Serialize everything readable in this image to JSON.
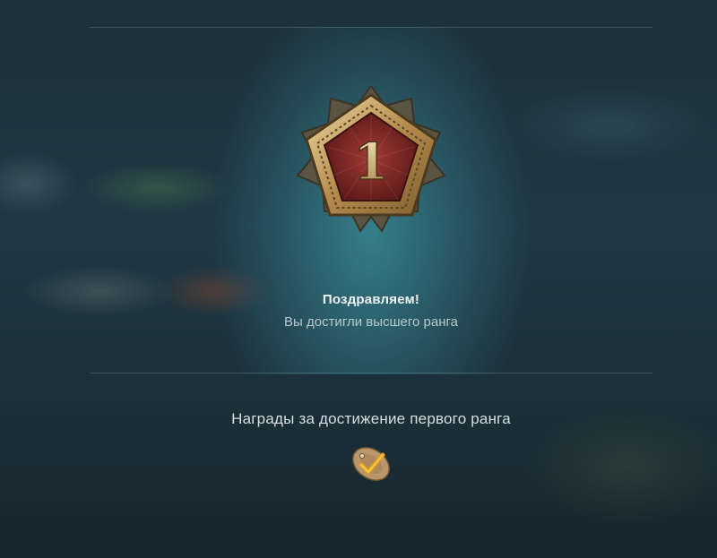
{
  "rank_popup": {
    "rank_number": "1",
    "congrats_title": "Поздравляем!",
    "congrats_subtitle": "Вы достигли высшего ранга",
    "rewards_title": "Награды за достижение первого ранга"
  },
  "colors": {
    "medal_red": "#8a2a2a",
    "medal_gold": "#c9a96a",
    "reward_gold": "#e0a020",
    "reward_tan": "#b9976a"
  },
  "icons": {
    "medal": "rank-1-medal-icon",
    "reward": "ship-camouflage-reward-icon"
  }
}
